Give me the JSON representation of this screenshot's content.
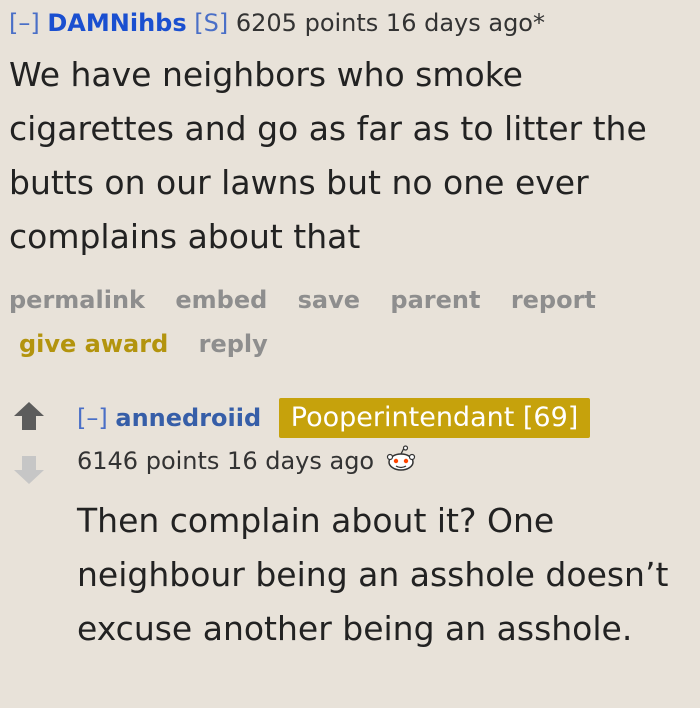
{
  "comment1": {
    "collapse": "[–]",
    "author": "DAMNihbs",
    "submitter_tag": "[S]",
    "meta": "6205 points 16 days ago*",
    "body": "We have neighbors who smoke cigarettes and go as far as to litter the butts on our lawns but no one ever complains about that",
    "buttons": {
      "permalink": "permalink",
      "embed": "embed",
      "save": "save",
      "parent": "parent",
      "report": "report",
      "give_award": "give award",
      "reply": "reply"
    }
  },
  "comment2": {
    "collapse": "[–]",
    "author": "annedroiid",
    "flair": "Pooperintendant [69]",
    "meta": "6146 points 16 days ago",
    "award_icon": "snoo-award-icon",
    "body": "Then complain about it? One neighbour being an asshole doesn’t excuse another being an asshole."
  },
  "colors": {
    "background": "#e8e2d9",
    "author_link": "#1a4fd0",
    "flair_bg": "#c6a20c",
    "give_award": "#b3940e",
    "button_gray": "#8e8e8e",
    "upvote": "#5c5c5c",
    "downvote": "#c6c6c6"
  }
}
